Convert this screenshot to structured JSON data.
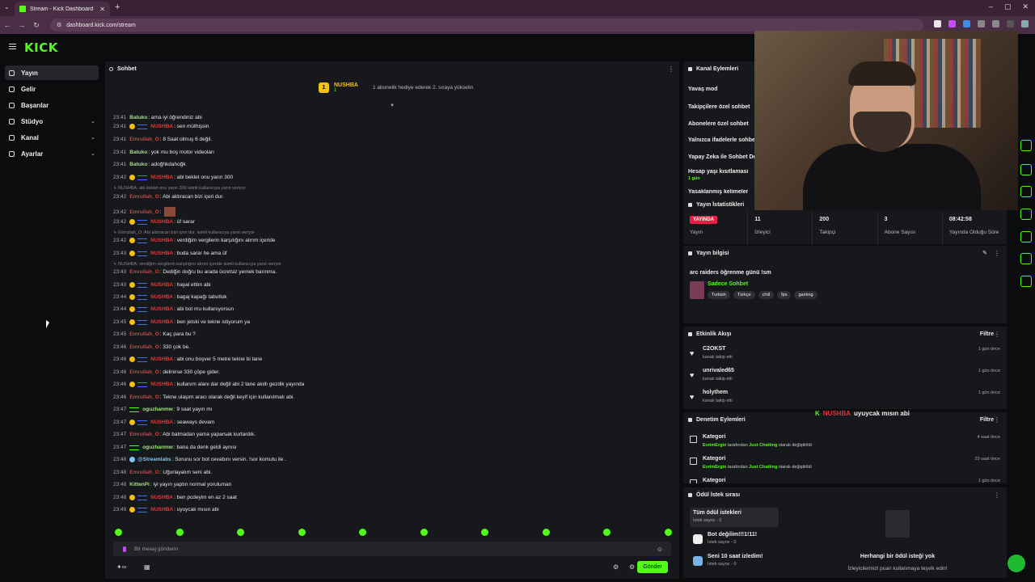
{
  "browser": {
    "tab_title": "Stream - Kick Dashboard",
    "url": "dashboard.kick.com/stream"
  },
  "app": {
    "logo": "KICK"
  },
  "sidebar": {
    "items": [
      {
        "label": "Yayın",
        "icon": "broadcast-icon",
        "active": true
      },
      {
        "label": "Gelir",
        "icon": "revenue-icon"
      },
      {
        "label": "Başarılar",
        "icon": "trophy-icon"
      },
      {
        "label": "Stüdyo",
        "icon": "studio-icon",
        "expandable": true
      },
      {
        "label": "Kanal",
        "icon": "channel-icon",
        "expandable": true
      },
      {
        "label": "Ayarlar",
        "icon": "settings-icon",
        "expandable": true
      }
    ]
  },
  "chat": {
    "title": "Sohbet",
    "pinned": {
      "badge": "1",
      "name": "NUSHBA",
      "count": "1",
      "info": "1 abonelik hediye ederek 2. sıraya yükselin"
    },
    "messages": [
      {
        "ts": "23:41",
        "user": "Batuko",
        "color": "#9fe870",
        "text": ": ama iyi öğrendiniz abi"
      },
      {
        "ts": "23:41",
        "user": "NUSHBA",
        "color": "#e03a3a",
        "badges": true,
        "text": ": sen müthişsin"
      },
      {
        "ts": "23:41",
        "user": "Emrullah_O",
        "color": "#e03a3a",
        "text": ": 8 Saat olmuş 6 değil."
      },
      {
        "ts": "23:41",
        "user": "Batuko",
        "color": "#9fe870",
        "text": ": yok mu boş motor videoları"
      },
      {
        "ts": "23:41",
        "user": "Batuko",
        "color": "#9fe870",
        "text": ": adoğhkdahoğk"
      },
      {
        "ts": "23:42",
        "user": "NUSHBA",
        "color": "#e03a3a",
        "badges": true,
        "text": ": abi beklet onu yarın 300"
      },
      {
        "reply": "↳ NUSHBA: abi beklet onu yarın 300 isimli kullanıcıya yanıt veriyor"
      },
      {
        "ts": "23:42",
        "user": "Emrullah_O",
        "color": "#e03a3a",
        "text": ": Abi aldıracan bizi içeri dur."
      },
      {
        "ts": "23:42",
        "user": "Emrullah_O",
        "color": "#e03a3a",
        "text": ":",
        "emote": true
      },
      {
        "ts": "23:42",
        "user": "NUSHBA",
        "color": "#e03a3a",
        "badges": true,
        "text": ": üf sarar"
      },
      {
        "reply": "↳ Emrullah_O: Abi aldıracan bizi içeri dur. isimli kullanıcıya yanıt veriyor"
      },
      {
        "ts": "23:42",
        "user": "NUSHBA",
        "color": "#e03a3a",
        "badges": true,
        "text": ": verdiğim vergilerin karşılığını alırım içeride"
      },
      {
        "ts": "23:43",
        "user": "NUSHBA",
        "color": "#e03a3a",
        "badges": true,
        "text": ": buda sarar he ama üf"
      },
      {
        "reply": "↳ NUSHBA: verdiğim vergilerin karşılığını alırım içeride isimli kullanıcıya yanıt veriyor"
      },
      {
        "ts": "23:43",
        "user": "Emrullah_O",
        "color": "#e03a3a",
        "text": ": Dediğin doğru bu arada ücretsiz yemek barınma."
      },
      {
        "ts": "23:43",
        "user": "NUSHBA",
        "color": "#e03a3a",
        "badges": true,
        "text": ": hayal ettim abi"
      },
      {
        "ts": "23:44",
        "user": "NUSHBA",
        "color": "#e03a3a",
        "badges": true,
        "text": ": bagaj kapağı tabutluk"
      },
      {
        "ts": "23:44",
        "user": "NUSHBA",
        "color": "#e03a3a",
        "badges": true,
        "text": ": abi bot mu kullanıyorsun"
      },
      {
        "ts": "23:45",
        "user": "NUSHBA",
        "color": "#e03a3a",
        "badges": true,
        "text": ": ben jetski ve tekne istiyorum ya"
      },
      {
        "ts": "23:45",
        "user": "Emrullah_O",
        "color": "#e03a3a",
        "text": ": Kaç para bu ?"
      },
      {
        "ts": "23:46",
        "user": "Emrullah_O",
        "color": "#e03a3a",
        "text": ": 330 çok be."
      },
      {
        "ts": "23:46",
        "user": "NUSHBA",
        "color": "#e03a3a",
        "badges": true,
        "text": ": abi onu boşver 5 metre tekne bi tane"
      },
      {
        "ts": "23:46",
        "user": "Emrullah_O",
        "color": "#e03a3a",
        "text": ": delinirse 330 çöpe gider."
      },
      {
        "ts": "23:46",
        "user": "NUSHBA",
        "color": "#e03a3a",
        "badges": true,
        "text": ": kullanım alanı dar değil abi 2 tane akıllı gezdik yayında"
      },
      {
        "ts": "23:46",
        "user": "Emrullah_O",
        "color": "#e03a3a",
        "text": ": Tekne ulaşım aracı olarak değil keyif için kullanılmalı abi."
      },
      {
        "ts": "23:47",
        "user": "oguzhanmw",
        "color": "#9fe870",
        "mod": true,
        "text": ": 9 saat yayın mı"
      },
      {
        "ts": "23:47",
        "user": "NUSHBA",
        "color": "#e03a3a",
        "badges": true,
        "text": ": seaways devam"
      },
      {
        "ts": "23:47",
        "user": "Emrullah_O",
        "color": "#e03a3a",
        "text": ": Abi batmadan yama yaparsak kurtardık."
      },
      {
        "ts": "23:47",
        "user": "oguzhanmw",
        "color": "#9fe870",
        "mod": true,
        "text": ": bana da denk geldi aynısı"
      },
      {
        "ts": "23:48",
        "user": "@Streamlabs",
        "color": "#7ec8f0",
        "bot": true,
        "text": ": Sorunu sor bot cevabını versin. !sor komutu ile ."
      },
      {
        "ts": "23:48",
        "user": "Emrullah_O",
        "color": "#e03a3a",
        "text": ": Uğurlayalım seni abi."
      },
      {
        "ts": "23:48",
        "user": "KittenPi",
        "color": "#9fe870",
        "text": ": iyi yayın yaptın normal yoruluman"
      },
      {
        "ts": "23:48",
        "user": "NUSHBA",
        "color": "#e03a3a",
        "badges": true,
        "text": ": ben pcdeyim en az 2 saat"
      },
      {
        "ts": "23:49",
        "user": "NUSHBA",
        "color": "#e03a3a",
        "badges": true,
        "text": ": uyuycak mısın abi"
      }
    ],
    "input_placeholder": "Bir mesaj gönderin",
    "send_label": "Gönder"
  },
  "channel_actions": {
    "title": "Kanal Eylemleri",
    "items": [
      "Yavaş mod",
      "Takipçilere özel sohbet",
      "Abonelere özel sohbet",
      "Yalnızca ifadelerle sohbet",
      "Yapay Zeka ile Sohbet De",
      "Hesap yaşı kısıtlaması",
      "Yasaklanmış kelimeler"
    ],
    "account_age_value": "1 gün"
  },
  "stream_stats": {
    "title": "Yayın İstatistikleri",
    "live_label": "YAYINDA",
    "live_caption": "Yayın",
    "stats": [
      {
        "value": "11",
        "label": "İzleyici"
      },
      {
        "value": "200",
        "label": "Takipçi"
      },
      {
        "value": "3",
        "label": "Abone Sayısı"
      },
      {
        "value": "08:42:58",
        "label": "Yayında Olduğu Süre"
      }
    ]
  },
  "stream_info": {
    "title": "Yayın bilgisi",
    "stream_title": "arc raiders öğrenme günü !sm",
    "category": "Sadece Sohbet",
    "tags": [
      "Turkish",
      "Türkçe",
      "chill",
      "fps",
      "gaming"
    ]
  },
  "activity": {
    "title": "Etkinlik Akışı",
    "filter_label": "Filtre",
    "items": [
      {
        "name": "C2OKST",
        "desc": "kanalı takip etti",
        "time": "1 gün önce"
      },
      {
        "name": "unrivaled65",
        "desc": "kanalı takip etti",
        "time": "1 gün önce"
      },
      {
        "name": "holythem",
        "desc": "kanalı takip etti",
        "time": "1 gün önce"
      }
    ]
  },
  "moderation": {
    "title": "Denetim Eylemleri",
    "filter_label": "Filtre",
    "items": [
      {
        "name": "Kategori",
        "user": "EvrimErgin",
        "mid": " tarafından ",
        "cat": "Just Chatting",
        "end": " olarak değiştirildi",
        "time": "4 saat önce"
      },
      {
        "name": "Kategori",
        "user": "EvrimErgin",
        "mid": " tarafından ",
        "cat": "Just Chatting",
        "end": " olarak değiştirildi",
        "time": "23 saat önce"
      },
      {
        "name": "Kategori",
        "time": "1 gün önce"
      }
    ]
  },
  "rewards": {
    "title": "Ödül İstek sırası",
    "items": [
      {
        "name": "Tüm ödül istekleri",
        "sub": "İstek sayısı - 0",
        "selected": true
      },
      {
        "name": "Bot değilim!!!1!11!",
        "sub": "İstek sayısı - 0"
      },
      {
        "name": "Seni 10 saat izledim!",
        "sub": "İstek sayısı - 0"
      }
    ],
    "empty_title": "Herhangi bir ödül isteği yok",
    "empty_sub": "İzleyicilerinizi puan kullanmaya teşvik edin!"
  },
  "overlay_chat": {
    "k": "K",
    "name": "NUSHBA",
    "message": "uyuycak mısın abi"
  },
  "colors": {
    "accent": "#53fc18",
    "live": "#e91e47",
    "panel": "#17181c",
    "bg": "#0b0c0e"
  }
}
